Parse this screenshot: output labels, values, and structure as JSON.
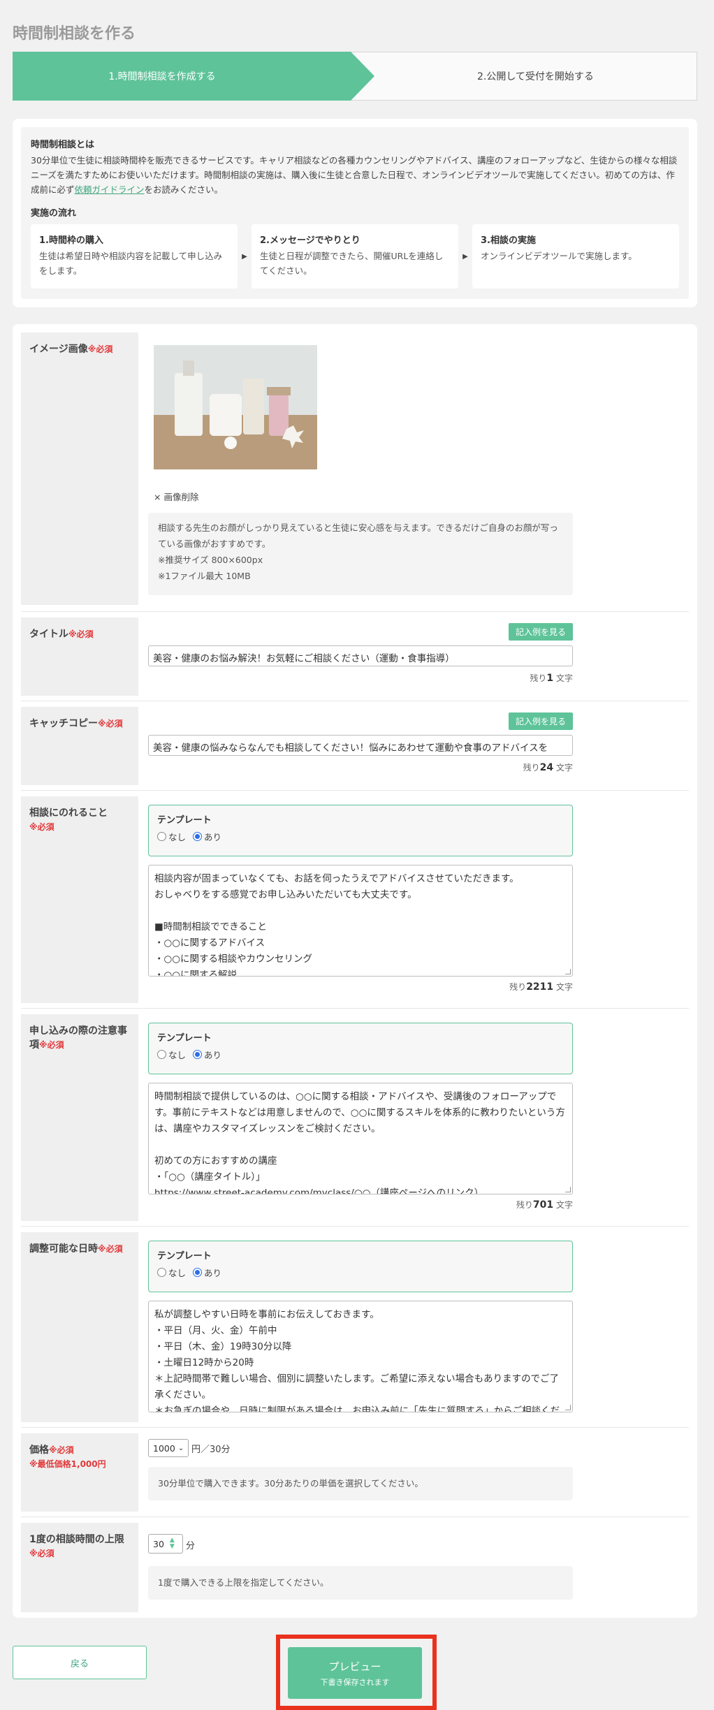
{
  "page_title": "時間制相談を作る",
  "steps": {
    "step1": "1.時間制相談を作成する",
    "step2": "2.公開して受付を開始する"
  },
  "intro": {
    "heading": "時間制相談とは",
    "body_before_link": "30分単位で生徒に相談時間枠を販売できるサービスです。キャリア相談などの各種カウンセリングやアドバイス、講座のフォローアップなど、生徒からの様々な相談ニーズを満たすためにお使いいただけます。時間制相談の実施は、購入後に生徒と合意した日程で、オンラインビデオツールで実施してください。初めての方は、作成前に必ず",
    "link": "依頼ガイドライン",
    "body_after_link": "をお読みください。",
    "flow_heading": "実施の流れ",
    "flow": [
      {
        "title": "1.時間枠の購入",
        "desc": "生徒は希望日時や相談内容を記載して申し込みをします。"
      },
      {
        "title": "2.メッセージでやりとり",
        "desc": "生徒と日程が調整できたら、開催URLを連絡してください。"
      },
      {
        "title": "3.相談の実施",
        "desc": "オンラインビデオツールで実施します。"
      }
    ],
    "arrow": "▶"
  },
  "required_mark": "※必須",
  "image": {
    "label": "イメージ画像",
    "delete": "× 画像削除",
    "note_lines": [
      "相談する先生のお顔がしっかり見えていると生徒に安心感を与えます。できるだけご自身のお顔が写っている画像がおすすめです。",
      "※推奨サイズ 800×600px",
      "※1ファイル最大 10MB"
    ]
  },
  "example_button": "記入例を見る",
  "remain_prefix": "残り",
  "remain_suffix": "文字",
  "title_field": {
    "label": "タイトル",
    "value": "美容・健康のお悩み解決！お気軽にご相談ください（運動・食事指導）",
    "remain": "1"
  },
  "catch_field": {
    "label": "キャッチコピー",
    "value": "美容・健康の悩みならなんでも相談してください！悩みにあわせて運動や食事のアドバイスを",
    "remain": "24"
  },
  "template": {
    "heading": "テンプレート",
    "none": "なし",
    "yes": "あり"
  },
  "consult_field": {
    "label": "相談にのれること",
    "value": "相談内容が固まっていなくても、お話を伺ったうえでアドバイスさせていただきます。\nおしゃべりをする感覚でお申し込みいただいても大丈夫です。\n\n■時間制相談でできること\n・○○に関するアドバイス\n・○○に関する相談やカウンセリング\n・○○に関する解説",
    "remain": "2211"
  },
  "notes_field": {
    "label": "申し込みの際の注意事項",
    "value": "時間制相談で提供しているのは、○○に関する相談・アドバイスや、受講後のフォローアップです。事前にテキストなどは用意しませんので、○○に関するスキルを体系的に教わりたいという方は、講座やカスタマイズレッスンをご検討ください。\n\n初めての方におすすめの講座\n・「○○（講座タイトル）」\nhttps://www.street-academy.com/myclass/○○（講座ページへのリンク）",
    "remain": "701"
  },
  "schedule_field": {
    "label": "調整可能な日時",
    "value": "私が調整しやすい日時を事前にお伝えしておきます。\n・平日（月、火、金）午前中\n・平日（木、金）19時30分以降\n・土曜日12時から20時\n＊上記時間帯で難しい場合、個別に調整いたします。ご希望に添えない場合もありますのでご了承ください。\n＊お急ぎの場合や、日時に制限がある場合は、お申込み前に「先生に質問する」からご相談ください。"
  },
  "price_field": {
    "label": "価格",
    "min_note": "※最低価格1,000円",
    "selected": "1000",
    "unit": "円／30分",
    "note": "30分単位で購入できます。30分あたりの単価を選択してください。"
  },
  "duration_field": {
    "label": "1度の相談時間の上限",
    "value": "30",
    "unit": "分",
    "note": "1度で購入できる上限を指定してください。"
  },
  "buttons": {
    "back": "戻る",
    "preview": "プレビュー",
    "preview_sub": "下書き保存されます"
  }
}
